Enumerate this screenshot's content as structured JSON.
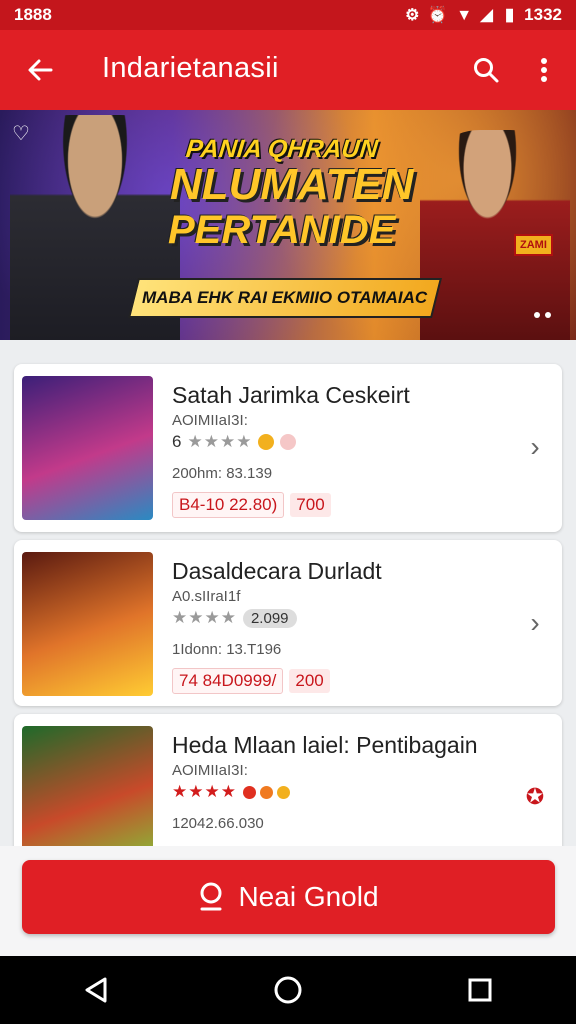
{
  "status_bar": {
    "time": "1888",
    "battery": "1332"
  },
  "app_bar": {
    "title": "Indarietanasii"
  },
  "banner": {
    "line1": "PANIA QHRAUN",
    "line2": "NLUMATEN",
    "line3": "PERTANIDE",
    "strip": "MABA EHK RAI EKMIIO OTAMAIAC",
    "badge": "ZAMI"
  },
  "games": [
    {
      "name": "Satah Jarimka Ceskeirt",
      "sub": "AOIMIIaI3I:",
      "rating_prefix": "6",
      "stars": "★★★★",
      "rating_badge": "",
      "meta": "200hm: 83.139",
      "price": "B4-10 22.80)",
      "price2": "700",
      "thumb_colors": [
        "#3b1f78",
        "#c23a8a",
        "#2a8ac2"
      ]
    },
    {
      "name": "Dasaldecara Durladt",
      "sub": "A0.sIIraI1f",
      "rating_prefix": "",
      "stars": "★★★★",
      "rating_badge": "2.099",
      "meta": "1Idonn: 13.T196",
      "price": "74 84D0999/",
      "price2": "200",
      "thumb_colors": [
        "#5a1a10",
        "#e0742a",
        "#ffcc33"
      ]
    },
    {
      "name": "Heda Mlaan laiel: Pentibagain",
      "sub": "AOIMIIaI3I:",
      "rating_prefix": "",
      "stars": "★★★★",
      "rating_badge": "",
      "meta": "12042.66.030",
      "price": "",
      "price2": "",
      "thumb_colors": [
        "#1e6a2a",
        "#c84a2a",
        "#7fc83a"
      ]
    }
  ],
  "cta": {
    "label": "Neai Gnold"
  }
}
